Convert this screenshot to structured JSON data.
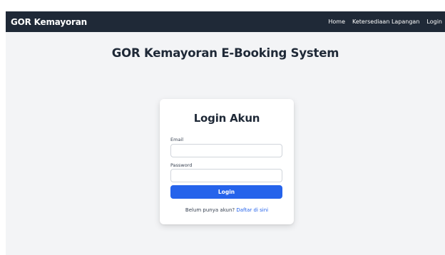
{
  "navbar": {
    "brand": "GOR Kemayoran",
    "links": [
      "Home",
      "Ketersediaan Lapangan",
      "Login"
    ]
  },
  "main": {
    "title": "GOR Kemayoran E-Booking System"
  },
  "login_card": {
    "title": "Login Akun",
    "email_label": "Email",
    "email_value": "",
    "password_label": "Password",
    "password_value": "",
    "button_label": "Login",
    "register_prompt": "Belum punya akun?",
    "register_link": "Daftar di sini"
  },
  "colors": {
    "navbar_bg": "#1f2937",
    "page_bg": "#f3f4f6",
    "primary": "#2563eb",
    "text_dark": "#1f2937"
  }
}
